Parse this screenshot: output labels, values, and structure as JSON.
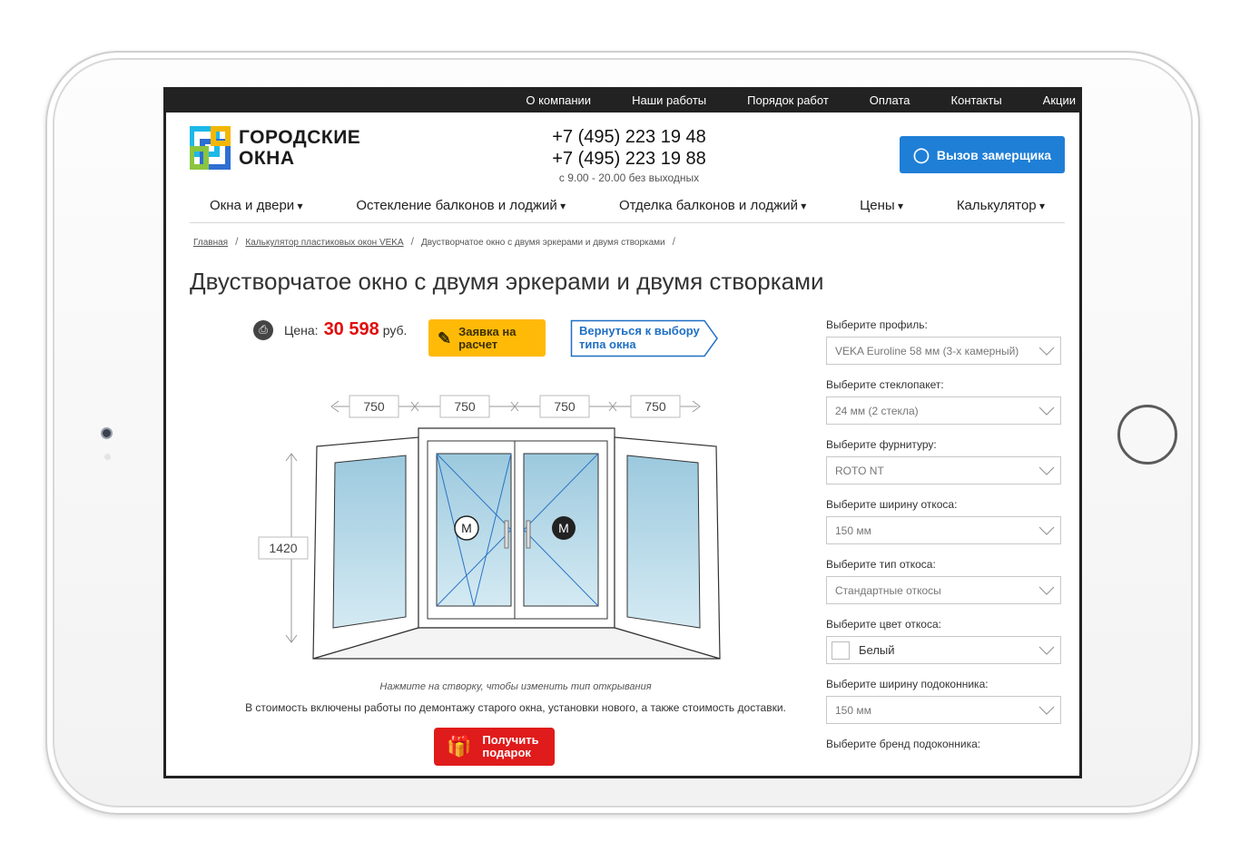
{
  "topnav": [
    "О компании",
    "Наши работы",
    "Порядок работ",
    "Оплата",
    "Контакты",
    "Акции"
  ],
  "logo": {
    "line1": "ГОРОДСКИЕ",
    "line2": "ОКНА"
  },
  "phones": [
    "+7 (495) 223 19 48",
    "+7 (495) 223 19 88"
  ],
  "hours": "с 9.00 - 20.00 без выходных",
  "cta": "Вызов замерщика",
  "mainnav": [
    "Окна и двери",
    "Остекление балконов и лоджий",
    "Отделка балконов и лоджий",
    "Цены",
    "Калькулятор"
  ],
  "breadcrumbs": [
    "Главная",
    "Калькулятор пластиковых окон VEKA",
    "Двустворчатое окно с двумя эркерами и двумя створками"
  ],
  "title": "Двустворчатое окно с двумя эркерами и двумя створками",
  "price": {
    "label": "Цена:",
    "value": "30 598",
    "currency": "руб."
  },
  "buttons": {
    "request": "Заявка на расчет",
    "back": "Вернуться к выбору типа окна",
    "gift": "Получить подарок"
  },
  "dimensions": {
    "widths": [
      "750",
      "750",
      "750",
      "750"
    ],
    "height": "1420"
  },
  "sash_marks": [
    "M",
    "M"
  ],
  "click_hint": "Нажмите на створку, чтобы изменить тип открывания",
  "included_note": "В стоимость включены работы по демонтажу старого окна, установки нового, а также стоимость доставки.",
  "config": [
    {
      "label": "Выберите профиль:",
      "value": "VEKA Euroline 58 мм (3-х камерный)"
    },
    {
      "label": "Выберите стеклопакет:",
      "value": "24 мм (2 стекла)"
    },
    {
      "label": "Выберите фурнитуру:",
      "value": "ROTO NT"
    },
    {
      "label": "Выберите ширину откоса:",
      "value": "150 мм"
    },
    {
      "label": "Выберите тип откоса:",
      "value": "Стандартные откосы"
    },
    {
      "label": "Выберите цвет откоса:",
      "value": "Белый"
    },
    {
      "label": "Выберите ширину подоконника:",
      "value": "150 мм"
    },
    {
      "label": "Выберите бренд подоконника:",
      "value": ""
    }
  ],
  "colors": {
    "accent": "#1f7fd6",
    "price": "#e20c0c",
    "request": "#ffba08",
    "gift": "#e01b1b",
    "topbar": "#222222"
  }
}
